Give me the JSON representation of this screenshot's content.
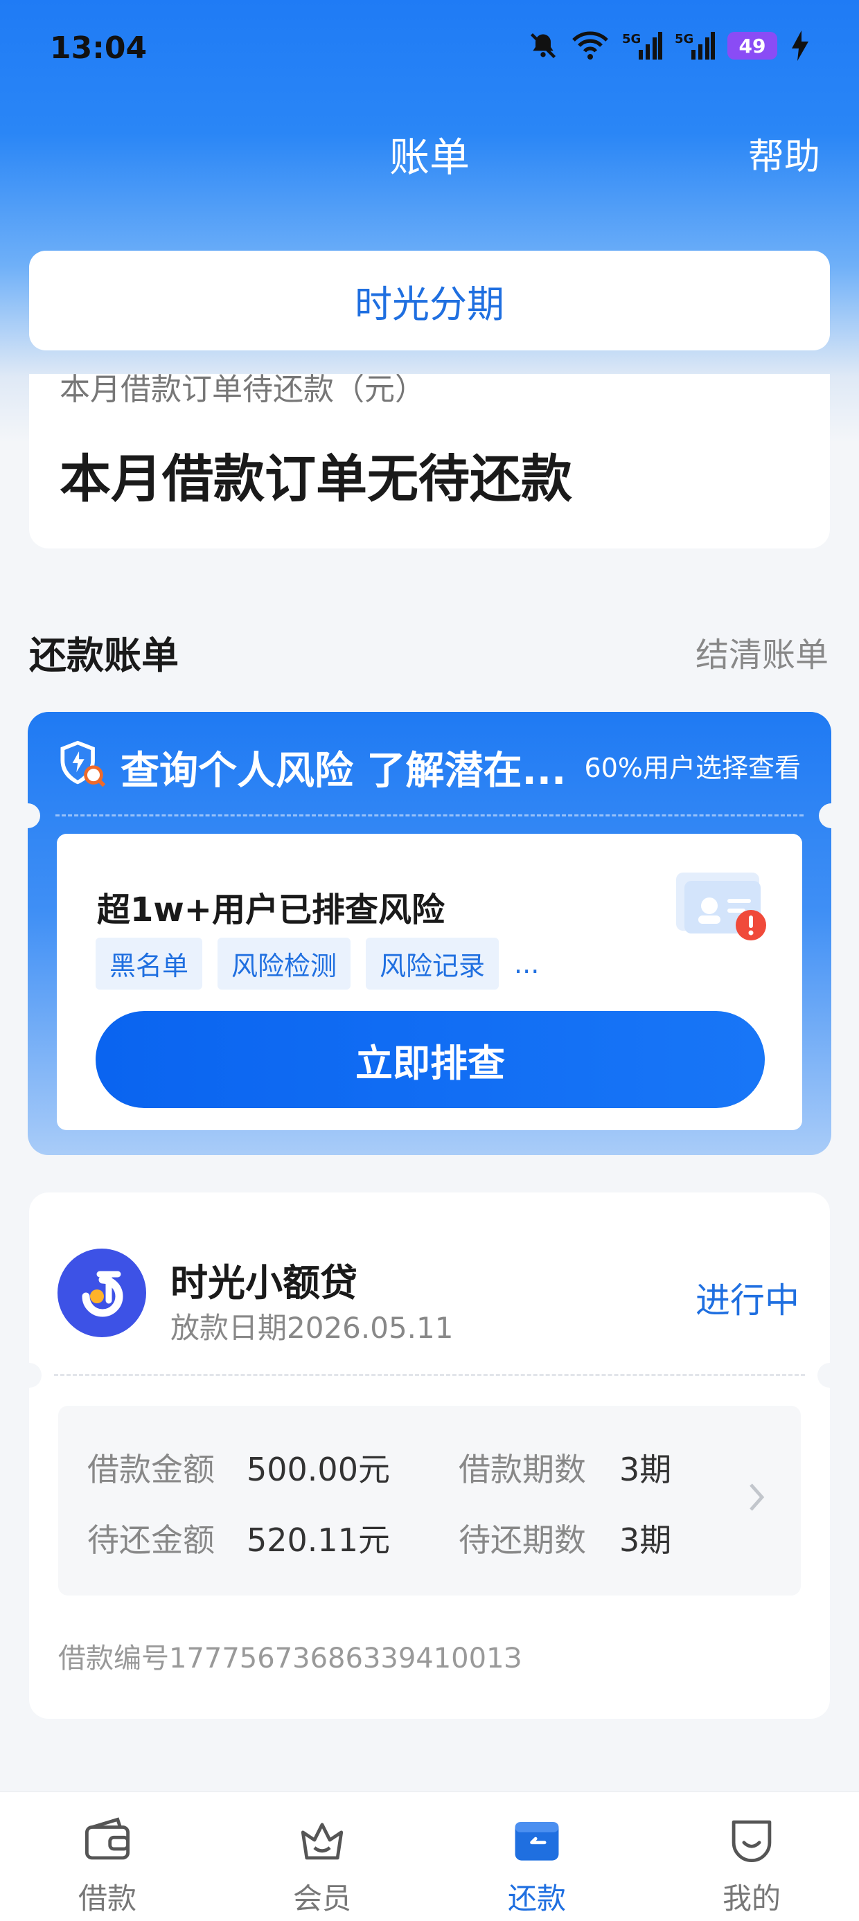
{
  "status_bar": {
    "time": "13:04",
    "battery": "49",
    "network_1": "5G",
    "network_2": "5G"
  },
  "header": {
    "title": "账单",
    "help": "帮助"
  },
  "product_tab": {
    "label": "时光分期"
  },
  "summary": {
    "subtitle": "本月借款订单待还款（元）",
    "main_text": "本月借款订单无待还款"
  },
  "section": {
    "title": "还款账单",
    "settled_link": "结清账单"
  },
  "risk_card": {
    "title": "查询个人风险 了解潜在...",
    "note": "60%用户选择查看",
    "headline": "超1w+用户已排查风险",
    "tags": [
      "黑名单",
      "风险检测",
      "风险记录"
    ],
    "tags_more": "...",
    "button": "立即排查"
  },
  "loan": {
    "name": "时光小额贷",
    "date": "放款日期2026.05.11",
    "status": "进行中",
    "amount_label": "借款金额",
    "amount_value": "500.00元",
    "periods_label": "借款期数",
    "periods_value": "3期",
    "due_label": "待还金额",
    "due_value": "520.11元",
    "due_periods_label": "待还期数",
    "due_periods_value": "3期",
    "loan_no": "借款编号1777567368633941001З"
  },
  "nav": [
    {
      "label": "借款",
      "icon": "wallet-icon"
    },
    {
      "label": "会员",
      "icon": "crown-basket-icon"
    },
    {
      "label": "还款",
      "icon": "repay-card-icon"
    },
    {
      "label": "我的",
      "icon": "smile-face-icon"
    }
  ],
  "colors": {
    "brand_blue": "#1f6fe0",
    "primary_gradient_start": "#0a64f0",
    "battery": "#8a4cf5"
  }
}
